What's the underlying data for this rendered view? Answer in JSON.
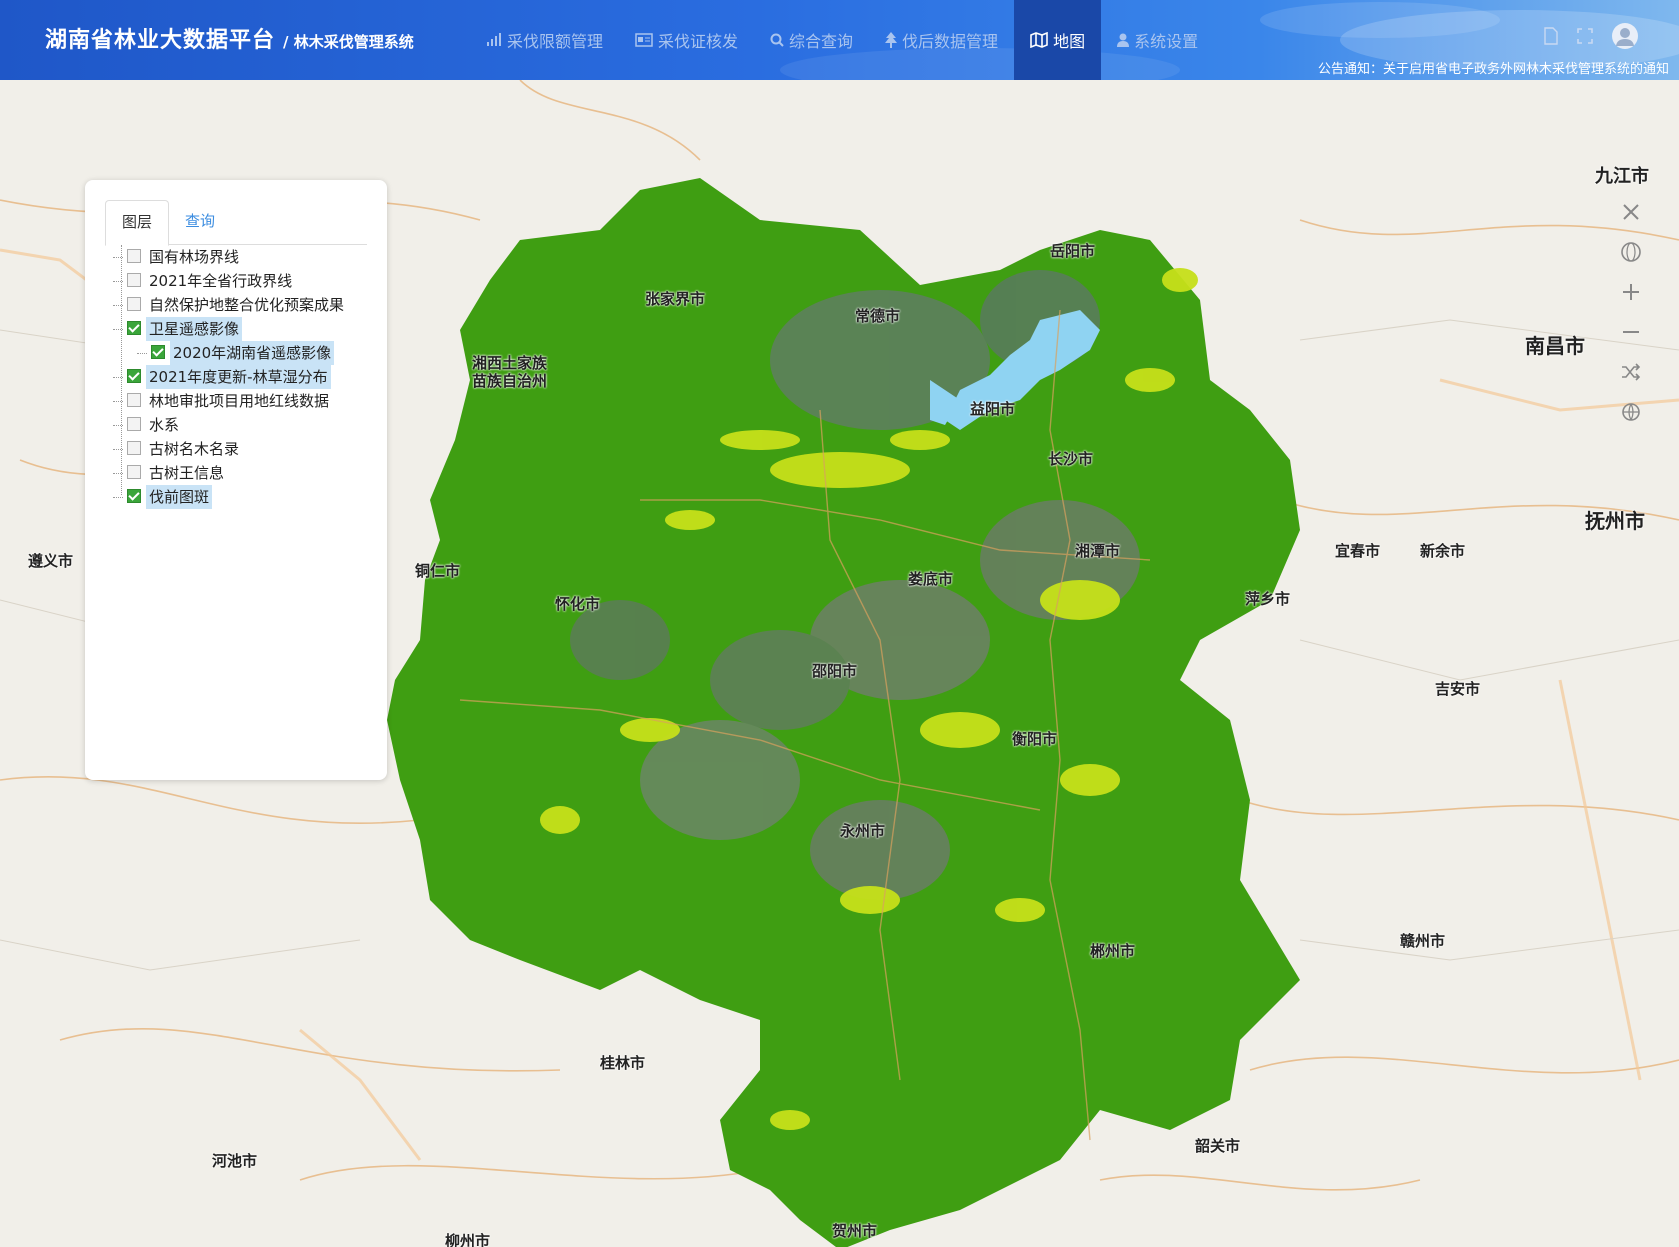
{
  "header": {
    "platform": "湖南省林业大数据平台",
    "system": "/ 林木采伐管理系统",
    "notice": "公告通知：关于启用省电子政务外网林木采伐管理系统的通知"
  },
  "nav": {
    "items": [
      {
        "label": "采伐限额管理",
        "icon": "bar-chart-icon"
      },
      {
        "label": "采伐证核发",
        "icon": "card-icon"
      },
      {
        "label": "综合查询",
        "icon": "search-icon"
      },
      {
        "label": "伐后数据管理",
        "icon": "tree-icon"
      },
      {
        "label": "地图",
        "icon": "map-icon",
        "active": true
      },
      {
        "label": "系统设置",
        "icon": "user-icon"
      }
    ]
  },
  "panel": {
    "tabs": {
      "layers": "图层",
      "query": "查询"
    },
    "layers": [
      {
        "label": "国有林场界线",
        "checked": false
      },
      {
        "label": "2021年全省行政界线",
        "checked": false
      },
      {
        "label": "自然保护地整合优化预案成果",
        "checked": false
      },
      {
        "label": "卫星遥感影像",
        "checked": true,
        "selected": true,
        "expanded": true,
        "children": [
          {
            "label": "2020年湖南省遥感影像",
            "checked": true,
            "selected": true
          }
        ]
      },
      {
        "label": "2021年度更新-林草湿分布",
        "checked": true,
        "selected": true
      },
      {
        "label": "林地审批项目用地红线数据",
        "checked": false
      },
      {
        "label": "水系",
        "checked": false
      },
      {
        "label": "古树名木名录",
        "checked": false
      },
      {
        "label": "古树王信息",
        "checked": false
      },
      {
        "label": "伐前图斑",
        "checked": true,
        "selected": true
      }
    ]
  },
  "map_labels": {
    "changsha": "长沙市",
    "yueyang": "岳阳市",
    "changde": "常德市",
    "yiyang": "益阳市",
    "zhangjiajie": "张家界市",
    "xiangxi1": "湘西土家族",
    "xiangxi2": "苗族自治州",
    "huaihua": "怀化市",
    "loudi": "娄底市",
    "shaoyang": "邵阳市",
    "xiangtan": "湘潭市",
    "hengyang": "衡阳市",
    "yongzhou": "永州市",
    "chenzhou": "郴州市",
    "nanchang": "南昌市",
    "fuzhou": "抚州市",
    "jiujiang": "九江市",
    "guilin": "桂林市",
    "hechi": "河池市",
    "liuzhou": "柳州市",
    "tongren": "铜仁市",
    "zunyi": "遵义市",
    "pingxiang": "萍乡市",
    "yichun": "宜春市",
    "ji_an": "吉安市",
    "ganzhou": "赣州市",
    "shaoguan": "韶关市",
    "hezhou": "贺州市",
    "xinyu": "新余市"
  },
  "colors": {
    "header": "#2a6de0",
    "nav_active": "#1a48a8",
    "forest": "#3f9e12",
    "forest_light": "#c6e01a",
    "water": "#8fd3f2",
    "map_bg": "#f1efe9"
  }
}
